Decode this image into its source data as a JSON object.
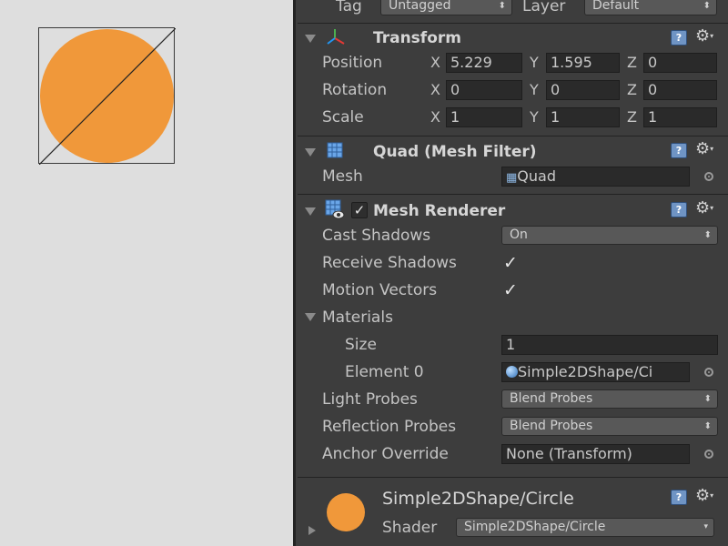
{
  "colors": {
    "circle": "#f0983a",
    "inspector_bg": "#3d3d3d",
    "field_bg": "#2a2a2a",
    "help_blue": "#6f94c4"
  },
  "top": {
    "tag_label": "Tag",
    "tag_value": "Untagged",
    "layer_label": "Layer",
    "layer_value": "Default"
  },
  "transform": {
    "title": "Transform",
    "position": {
      "label": "Position",
      "x": "5.229",
      "y": "1.595",
      "z": "0"
    },
    "rotation": {
      "label": "Rotation",
      "x": "0",
      "y": "0",
      "z": "0"
    },
    "scale": {
      "label": "Scale",
      "x": "1",
      "y": "1",
      "z": "1"
    },
    "axes": {
      "x": "X",
      "y": "Y",
      "z": "Z"
    }
  },
  "mesh_filter": {
    "title": "Quad (Mesh Filter)",
    "mesh_label": "Mesh",
    "mesh_value": "Quad"
  },
  "mesh_renderer": {
    "title": "Mesh Renderer",
    "enabled_mark": "✓",
    "cast_shadows_label": "Cast Shadows",
    "cast_shadows_value": "On",
    "receive_shadows_label": "Receive Shadows",
    "receive_shadows_mark": "✓",
    "motion_vectors_label": "Motion Vectors",
    "motion_vectors_mark": "✓",
    "materials_label": "Materials",
    "size_label": "Size",
    "size_value": "1",
    "element0_label": "Element 0",
    "element0_value": "Simple2DShape/Ci",
    "light_probes_label": "Light Probes",
    "light_probes_value": "Blend Probes",
    "reflection_probes_label": "Reflection Probes",
    "reflection_probes_value": "Blend Probes",
    "anchor_override_label": "Anchor Override",
    "anchor_override_value": "None (Transform)"
  },
  "material": {
    "name": "Simple2DShape/Circle",
    "shader_label": "Shader",
    "shader_value": "Simple2DShape/Circle"
  },
  "icons": {
    "help": "?",
    "gear": "⚙",
    "gear_caret": "▾",
    "dropdown_arrow": "⬍",
    "dropdown_caret": "▾"
  }
}
